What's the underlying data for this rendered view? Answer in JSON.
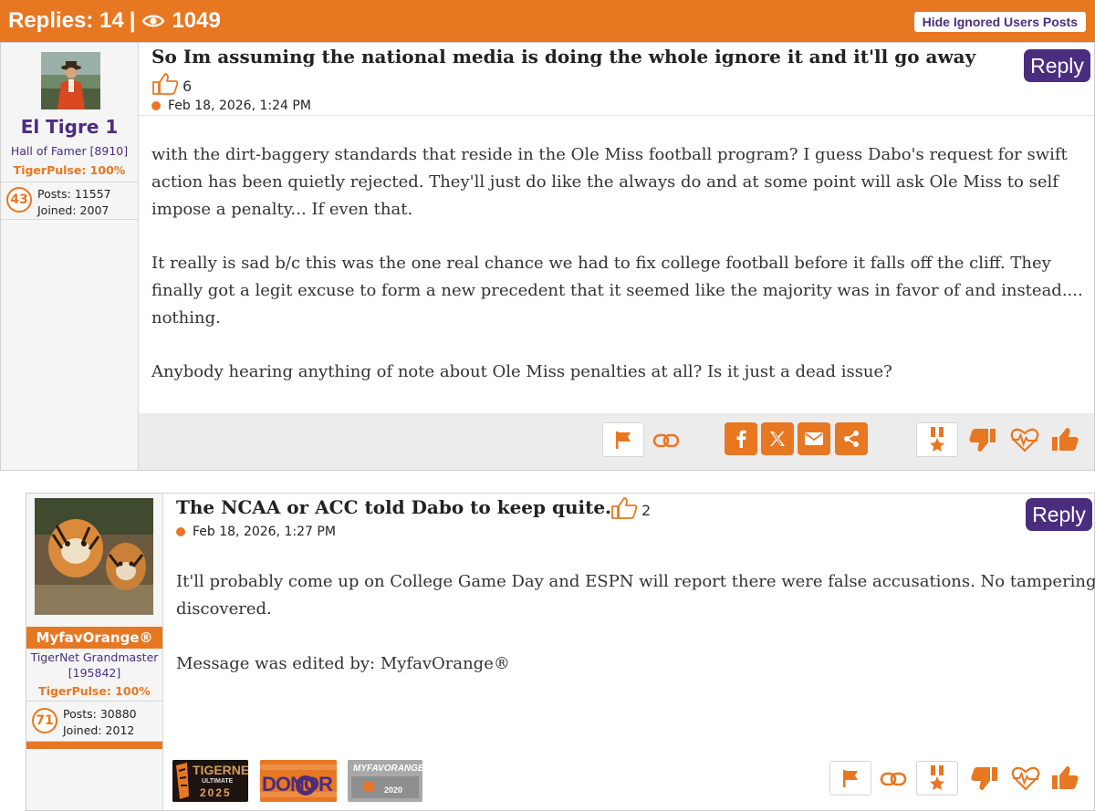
{
  "topbar": {
    "replies_text": "Replies: 14",
    "separator": "|",
    "views": "1049",
    "hide_button": "Hide Ignored Users Posts"
  },
  "posts": [
    {
      "username": "El Tigre 1",
      "rank": "Hall of Famer [8910]",
      "tigerpulse": "TigerPulse: 100%",
      "level": "43",
      "posts_stat": "Posts: 11557",
      "joined_stat": "Joined: 2007",
      "title": "So Im assuming the national media is doing the whole ignore it and it'll go away",
      "likes": "6",
      "date": "Feb 18, 2026, 1:24 PM",
      "reply_label": "Reply",
      "paragraphs": [
        "with the dirt-baggery standards that reside in the Ole Miss football program? I guess Dabo's request for swift action has been quietly rejected. They'll just do like the always do and at some point will ask Ole Miss to self impose a penalty... If even that.",
        "It really is sad b/c this was the one real chance we had to fix college football before it falls off the cliff. They finally got a legit excuse to form a new precedent that it seemed like the majority was in favor of and instead.... nothing.",
        "Anybody hearing anything of note about Ole Miss penalties at all? Is it just a dead issue?"
      ]
    },
    {
      "username": "MyfavOrange®",
      "rank": "TigerNet Grandmaster [195842]",
      "tigerpulse": "TigerPulse: 100%",
      "level": "71",
      "posts_stat": "Posts: 30880",
      "joined_stat": "Joined: 2012",
      "title": "The NCAA or ACC told Dabo to keep quite.",
      "likes": "2",
      "date": "Feb 18, 2026, 1:27 PM",
      "reply_label": "Reply",
      "paragraphs": [
        "It'll probably come up on College Game Day and ESPN will report there were false accusations. No tampering discovered.",
        "Message was edited by: MyfavOrange®"
      ],
      "badges": [
        {
          "text_top": "TIGERNET",
          "text_mid": "ULTIMATE",
          "text_bot": "2025"
        },
        {
          "text_top": "DONOR"
        },
        {
          "text_top": "MYFAVORANGE",
          "text_bot": "2020"
        }
      ]
    }
  ],
  "icons": {
    "eye": "eye-icon",
    "thumb_outline": "thumbs-up-outline-icon",
    "flag": "flag-icon",
    "link": "link-icon",
    "facebook": "facebook-icon",
    "x": "x-icon",
    "mail": "mail-icon",
    "share": "share-icon",
    "medal": "medal-icon",
    "thumb_down": "thumbs-down-icon",
    "heart": "heart-pulse-icon",
    "thumb_up": "thumbs-up-icon"
  },
  "colors": {
    "orange": "#e87722",
    "purple": "#4b2d7f"
  }
}
